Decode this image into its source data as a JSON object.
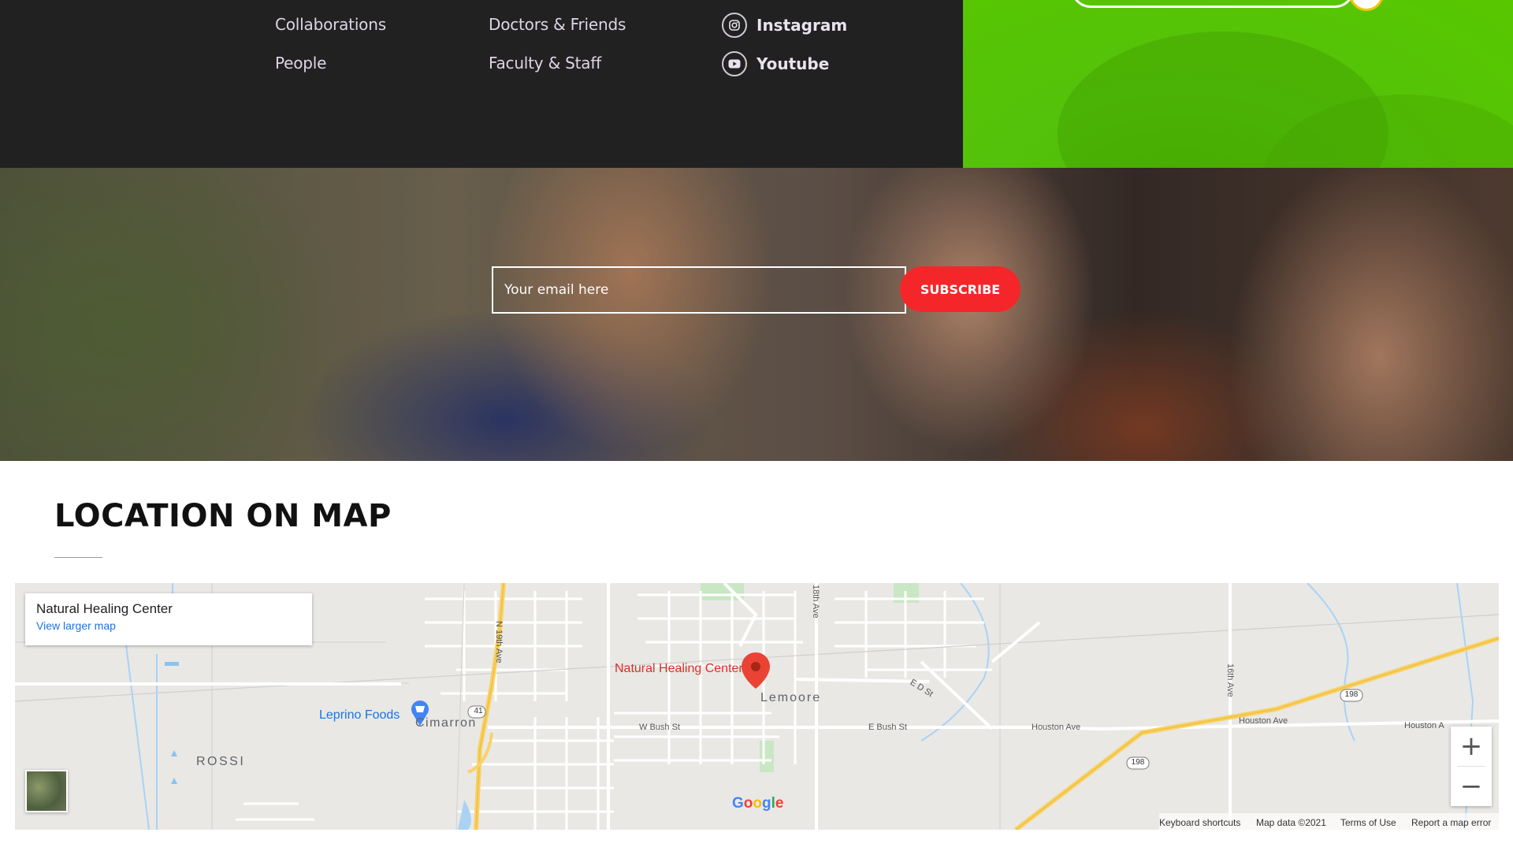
{
  "footer": {
    "links_col1": [
      "Collaborations",
      "People"
    ],
    "links_col2": [
      "Doctors & Friends",
      "Faculty & Staff"
    ],
    "social": [
      {
        "label": "Instagram",
        "icon": "instagram-icon"
      },
      {
        "label": "Youtube",
        "icon": "youtube-icon"
      }
    ],
    "colors": {
      "dark_bg": "#222121",
      "green_bg": "#58c700"
    }
  },
  "subscribe": {
    "placeholder": "Your email here",
    "button_label": "SUBSCRIBE",
    "button_color": "#f5262a"
  },
  "location": {
    "title": "LOCATION ON MAP"
  },
  "map": {
    "card_title": "Natural Healing Center",
    "card_link": "View larger map",
    "pin_label": "Natural Healing Center",
    "places": {
      "lemoore": "Lemoore",
      "cimarron": "Cimarron",
      "rossi": "ROSSI",
      "leprino": "Leprino Foods"
    },
    "streets": {
      "n19th": "N 19th Ave",
      "n18th": "18th Ave",
      "n16th": "16th Ave",
      "w_bush": "W Bush St",
      "e_bush": "E Bush St",
      "e_d": "E D St",
      "houston1": "Houston Ave",
      "houston2": "Houston Ave",
      "houston3": "Houston A"
    },
    "shields": {
      "r41": "41",
      "r198a": "198",
      "r198b": "198"
    },
    "google": [
      "G",
      "o",
      "o",
      "g",
      "l",
      "e"
    ],
    "zoom_in": "+",
    "zoom_out": "−",
    "attribution": {
      "shortcuts": "Keyboard shortcuts",
      "data": "Map data ©2021",
      "terms": "Terms of Use",
      "report": "Report a map error"
    }
  }
}
